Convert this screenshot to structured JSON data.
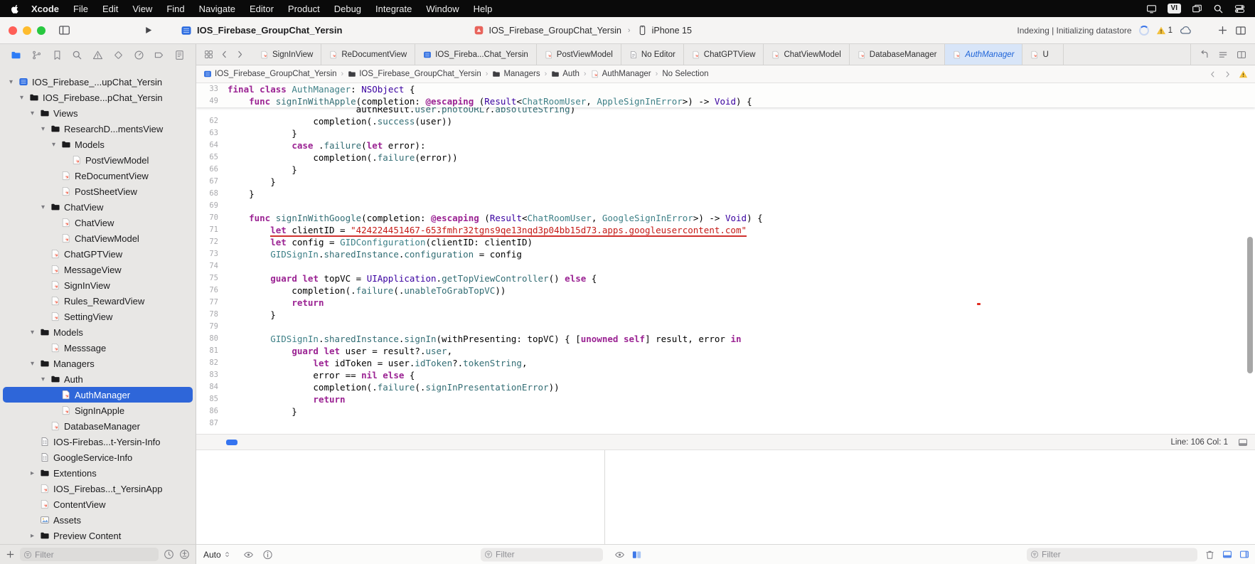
{
  "menu_bar": {
    "items": [
      "Xcode",
      "File",
      "Edit",
      "View",
      "Find",
      "Navigate",
      "Editor",
      "Product",
      "Debug",
      "Integrate",
      "Window",
      "Help"
    ],
    "input_source_badge": "VI"
  },
  "toolbar": {
    "project_title": "IOS_Firebase_GroupChat_Yersin",
    "scheme_name": "IOS_Firebase_GroupChat_Yersin",
    "run_destination": "iPhone 15",
    "status_text": "Indexing | Initializing datastore",
    "warning_count": "1"
  },
  "tab_bar": {
    "tabs": [
      {
        "label": "SignInView",
        "icon": "swift"
      },
      {
        "label": "ReDocumentView",
        "icon": "swift"
      },
      {
        "label": "IOS_Fireba...Chat_Yersin",
        "icon": "project"
      },
      {
        "label": "PostViewModel",
        "icon": "swift"
      },
      {
        "label": "No Editor",
        "icon": "doc"
      },
      {
        "label": "ChatGPTView",
        "icon": "swift"
      },
      {
        "label": "ChatViewModel",
        "icon": "swift"
      },
      {
        "label": "DatabaseManager",
        "icon": "swift"
      },
      {
        "label": "AuthManager",
        "icon": "swift",
        "selected": true
      },
      {
        "label": "U",
        "icon": "swift",
        "partial": true
      }
    ]
  },
  "jump_bar": {
    "items": [
      {
        "label": "IOS_Firebase_GroupChat_Yersin",
        "icon": "project"
      },
      {
        "label": "IOS_Firebase_GroupChat_Yersin",
        "icon": "folder"
      },
      {
        "label": "Managers",
        "icon": "folder"
      },
      {
        "label": "Auth",
        "icon": "folder"
      },
      {
        "label": "AuthManager",
        "icon": "swift"
      },
      {
        "label": "No Selection",
        "icon": "none"
      }
    ]
  },
  "navigator": {
    "filter_placeholder": "Filter",
    "tree": [
      {
        "label": "IOS_Firebase_...upChat_Yersin",
        "depth": 0,
        "icon": "project",
        "disclosure": "open"
      },
      {
        "label": "IOS_Firebase...pChat_Yersin",
        "depth": 1,
        "icon": "folder",
        "disclosure": "open"
      },
      {
        "label": "Views",
        "depth": 2,
        "icon": "folder",
        "disclosure": "open"
      },
      {
        "label": "ResearchD...mentsView",
        "depth": 3,
        "icon": "folder",
        "disclosure": "open"
      },
      {
        "label": "Models",
        "depth": 4,
        "icon": "folder",
        "disclosure": "open"
      },
      {
        "label": "PostViewModel",
        "depth": 5,
        "icon": "swift"
      },
      {
        "label": "ReDocumentView",
        "depth": 4,
        "icon": "swift"
      },
      {
        "label": "PostSheetView",
        "depth": 4,
        "icon": "swift"
      },
      {
        "label": "ChatView",
        "depth": 3,
        "icon": "folder",
        "disclosure": "open"
      },
      {
        "label": "ChatView",
        "depth": 4,
        "icon": "swift"
      },
      {
        "label": "ChatViewModel",
        "depth": 4,
        "icon": "swift"
      },
      {
        "label": "ChatGPTView",
        "depth": 3,
        "icon": "swift"
      },
      {
        "label": "MessageView",
        "depth": 3,
        "icon": "swift"
      },
      {
        "label": "SignInView",
        "depth": 3,
        "icon": "swift"
      },
      {
        "label": "Rules_RewardView",
        "depth": 3,
        "icon": "swift"
      },
      {
        "label": "SettingView",
        "depth": 3,
        "icon": "swift"
      },
      {
        "label": "Models",
        "depth": 2,
        "icon": "folder",
        "disclosure": "open"
      },
      {
        "label": "Messsage",
        "depth": 3,
        "icon": "swift"
      },
      {
        "label": "Managers",
        "depth": 2,
        "icon": "folder",
        "disclosure": "open"
      },
      {
        "label": "Auth",
        "depth": 3,
        "icon": "folder",
        "disclosure": "open"
      },
      {
        "label": "AuthManager",
        "depth": 4,
        "icon": "swift",
        "selected": true
      },
      {
        "label": "SignInApple",
        "depth": 4,
        "icon": "swift"
      },
      {
        "label": "DatabaseManager",
        "depth": 3,
        "icon": "swift"
      },
      {
        "label": "IOS-Firebas...t-Yersin-Info",
        "depth": 2,
        "icon": "plist"
      },
      {
        "label": "GoogleService-Info",
        "depth": 2,
        "icon": "plist"
      },
      {
        "label": "Extentions",
        "depth": 2,
        "icon": "folder",
        "disclosure": "closed"
      },
      {
        "label": "IOS_Firebas...t_YersinApp",
        "depth": 2,
        "icon": "swift"
      },
      {
        "label": "ContentView",
        "depth": 2,
        "icon": "swift"
      },
      {
        "label": "Assets",
        "depth": 2,
        "icon": "assets"
      },
      {
        "label": "Preview Content",
        "depth": 2,
        "icon": "folder",
        "disclosure": "closed"
      }
    ]
  },
  "editor": {
    "status": "Line: 106 Col: 1",
    "sticky_lines": [
      {
        "num": 33,
        "tokens": [
          [
            "kw",
            "final"
          ],
          [
            "pl",
            " "
          ],
          [
            "kw",
            "class"
          ],
          [
            "pl",
            " "
          ],
          [
            "pr",
            "AuthManager"
          ],
          [
            "pl",
            ": "
          ],
          [
            "ty",
            "NSObject"
          ],
          [
            "pl",
            " {"
          ]
        ]
      },
      {
        "num": 49,
        "tokens": [
          [
            "pl",
            "    "
          ],
          [
            "kw",
            "func"
          ],
          [
            "pl",
            " "
          ],
          [
            "fn",
            "signInWithApple"
          ],
          [
            "pl",
            "(completion: "
          ],
          [
            "kw",
            "@escaping"
          ],
          [
            "pl",
            " ("
          ],
          [
            "ty",
            "Result"
          ],
          [
            "pl",
            "<"
          ],
          [
            "pr",
            "ChatRoomUser"
          ],
          [
            "pl",
            ", "
          ],
          [
            "pr",
            "AppleSignInError"
          ],
          [
            "pl",
            ">) -> "
          ],
          [
            "ty",
            "Void"
          ],
          [
            "pl",
            ") {"
          ]
        ]
      }
    ],
    "partial_line": {
      "num": null,
      "tokens": [
        [
          "pl",
          "                        authResult."
        ],
        [
          "fn",
          "user"
        ],
        [
          "pl",
          "."
        ],
        [
          "fn",
          "photoURL"
        ],
        [
          "pl",
          "?."
        ],
        [
          "fn",
          "absoluteString"
        ],
        [
          "pl",
          ")"
        ]
      ]
    },
    "lines": [
      {
        "num": 62,
        "tokens": [
          [
            "pl",
            "                completion(."
          ],
          [
            "fn",
            "success"
          ],
          [
            "pl",
            "(user))"
          ]
        ]
      },
      {
        "num": 63,
        "tokens": [
          [
            "pl",
            "            }"
          ]
        ]
      },
      {
        "num": 64,
        "tokens": [
          [
            "pl",
            "            "
          ],
          [
            "kw",
            "case"
          ],
          [
            "pl",
            " ."
          ],
          [
            "fn",
            "failure"
          ],
          [
            "pl",
            "("
          ],
          [
            "kw",
            "let"
          ],
          [
            "pl",
            " error):"
          ]
        ]
      },
      {
        "num": 65,
        "tokens": [
          [
            "pl",
            "                completion(."
          ],
          [
            "fn",
            "failure"
          ],
          [
            "pl",
            "(error))"
          ]
        ]
      },
      {
        "num": 66,
        "tokens": [
          [
            "pl",
            "            }"
          ]
        ]
      },
      {
        "num": 67,
        "tokens": [
          [
            "pl",
            "        }"
          ]
        ]
      },
      {
        "num": 68,
        "tokens": [
          [
            "pl",
            "    }"
          ]
        ]
      },
      {
        "num": 69,
        "tokens": []
      },
      {
        "num": 70,
        "tokens": [
          [
            "pl",
            "    "
          ],
          [
            "kw",
            "func"
          ],
          [
            "pl",
            " "
          ],
          [
            "fn",
            "signInWithGoogle"
          ],
          [
            "pl",
            "(completion: "
          ],
          [
            "kw",
            "@escaping"
          ],
          [
            "pl",
            " ("
          ],
          [
            "ty",
            "Result"
          ],
          [
            "pl",
            "<"
          ],
          [
            "pr",
            "ChatRoomUser"
          ],
          [
            "pl",
            ", "
          ],
          [
            "pr",
            "GoogleSignInError"
          ],
          [
            "pl",
            ">) -> "
          ],
          [
            "ty",
            "Void"
          ],
          [
            "pl",
            ") {"
          ]
        ]
      },
      {
        "num": 71,
        "underline": true,
        "tokens": [
          [
            "pl",
            "        "
          ],
          [
            "kw",
            "let"
          ],
          [
            "pl",
            " clientID = "
          ],
          [
            "st",
            "\"424224451467-653fmhr32tgns9qe13nqd3p04bb15d73.apps.googleusercontent.com\""
          ]
        ]
      },
      {
        "num": 72,
        "tokens": [
          [
            "pl",
            "        "
          ],
          [
            "kw",
            "let"
          ],
          [
            "pl",
            " config = "
          ],
          [
            "pr",
            "GIDConfiguration"
          ],
          [
            "pl",
            "(clientID: clientID)"
          ]
        ]
      },
      {
        "num": 73,
        "tokens": [
          [
            "pl",
            "        "
          ],
          [
            "pr",
            "GIDSignIn"
          ],
          [
            "pl",
            "."
          ],
          [
            "fn",
            "sharedInstance"
          ],
          [
            "pl",
            "."
          ],
          [
            "fn",
            "configuration"
          ],
          [
            "pl",
            " = config"
          ]
        ]
      },
      {
        "num": 74,
        "tokens": []
      },
      {
        "num": 75,
        "tokens": [
          [
            "pl",
            "        "
          ],
          [
            "kw",
            "guard"
          ],
          [
            "pl",
            " "
          ],
          [
            "kw",
            "let"
          ],
          [
            "pl",
            " topVC = "
          ],
          [
            "ty",
            "UIApplication"
          ],
          [
            "pl",
            "."
          ],
          [
            "fn",
            "getTopViewController"
          ],
          [
            "pl",
            "() "
          ],
          [
            "kw",
            "else"
          ],
          [
            "pl",
            " {"
          ]
        ]
      },
      {
        "num": 76,
        "tokens": [
          [
            "pl",
            "            completion(."
          ],
          [
            "fn",
            "failure"
          ],
          [
            "pl",
            "(."
          ],
          [
            "fn",
            "unableToGrabTopVC"
          ],
          [
            "pl",
            "))"
          ]
        ]
      },
      {
        "num": 77,
        "tokens": [
          [
            "pl",
            "            "
          ],
          [
            "kw",
            "return"
          ]
        ]
      },
      {
        "num": 78,
        "tokens": [
          [
            "pl",
            "        }"
          ]
        ]
      },
      {
        "num": 79,
        "tokens": []
      },
      {
        "num": 80,
        "tokens": [
          [
            "pl",
            "        "
          ],
          [
            "pr",
            "GIDSignIn"
          ],
          [
            "pl",
            "."
          ],
          [
            "fn",
            "sharedInstance"
          ],
          [
            "pl",
            "."
          ],
          [
            "fn",
            "signIn"
          ],
          [
            "pl",
            "(withPresenting: topVC) { ["
          ],
          [
            "kw",
            "unowned"
          ],
          [
            "pl",
            " "
          ],
          [
            "kw",
            "self"
          ],
          [
            "pl",
            "] result, error "
          ],
          [
            "kw",
            "in"
          ]
        ]
      },
      {
        "num": 81,
        "tokens": [
          [
            "pl",
            "            "
          ],
          [
            "kw",
            "guard"
          ],
          [
            "pl",
            " "
          ],
          [
            "kw",
            "let"
          ],
          [
            "pl",
            " user = result?."
          ],
          [
            "fn",
            "user"
          ],
          [
            "pl",
            ","
          ]
        ]
      },
      {
        "num": 82,
        "tokens": [
          [
            "pl",
            "                "
          ],
          [
            "kw",
            "let"
          ],
          [
            "pl",
            " idToken = user."
          ],
          [
            "fn",
            "idToken"
          ],
          [
            "pl",
            "?."
          ],
          [
            "fn",
            "tokenString"
          ],
          [
            "pl",
            ","
          ]
        ]
      },
      {
        "num": 83,
        "tokens": [
          [
            "pl",
            "                error == "
          ],
          [
            "kw",
            "nil"
          ],
          [
            "pl",
            " "
          ],
          [
            "kw",
            "else"
          ],
          [
            "pl",
            " {"
          ]
        ]
      },
      {
        "num": 84,
        "tokens": [
          [
            "pl",
            "                completion(."
          ],
          [
            "fn",
            "failure"
          ],
          [
            "pl",
            "(."
          ],
          [
            "fn",
            "signInPresentationError"
          ],
          [
            "pl",
            "))"
          ]
        ]
      },
      {
        "num": 85,
        "tokens": [
          [
            "pl",
            "                "
          ],
          [
            "kw",
            "return"
          ]
        ]
      },
      {
        "num": 86,
        "tokens": [
          [
            "pl",
            "            }"
          ]
        ]
      },
      {
        "num": 87,
        "tokens": []
      }
    ]
  },
  "debug_bar": {
    "scope_selector": "Auto",
    "variables_filter_placeholder": "Filter",
    "console_filter_placeholder": "Filter"
  },
  "colors": {
    "accent_blue": "#2d6ce0",
    "selection_blue": "#2e66d9",
    "selected_tab_bg": "#d8e5f8",
    "swift_orange": "#f05138",
    "error_red": "#d0312d",
    "keyword": "#9b2393",
    "string": "#c41a16",
    "system_type": "#3900a0",
    "project_type": "#3e8087",
    "member": "#326d74",
    "warning_yellow": "#f3c13f"
  }
}
